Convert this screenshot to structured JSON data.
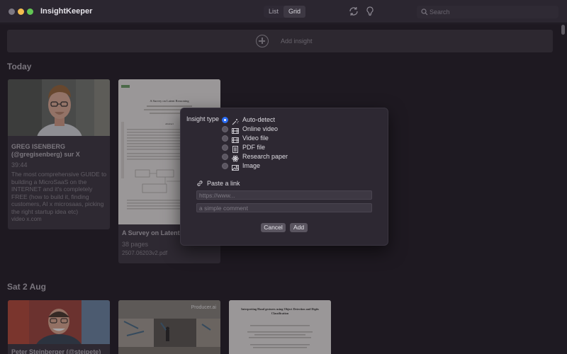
{
  "app": {
    "title": "InsightKeeper"
  },
  "toolbar": {
    "view_modes": [
      {
        "label": "List",
        "active": false
      },
      {
        "label": "Grid",
        "active": true
      }
    ],
    "refresh_icon": "refresh-icon",
    "lightbulb_icon": "lightbulb-icon",
    "search": {
      "placeholder": "Search",
      "value": ""
    }
  },
  "add_bar": {
    "label": "Add insight",
    "icon": "plus-circle-icon"
  },
  "sections": [
    {
      "title": "Today",
      "cards": [
        {
          "title_line1": "GREG ISENBERG",
          "title_line2": "(@gregisenberg) sur X",
          "meta": "39:44",
          "description_lines": [
            "The most comprehensive GUIDE to",
            "building a MicroSaaS on the",
            "INTERNET and it's completely",
            "FREE (how to build it, finding",
            "customers, AI x microsaas, picking",
            "the right startup idea etc)"
          ],
          "source": "video x.com"
        },
        {
          "title_line1": "A Survey on Latent Reasoning",
          "meta": "38 pages",
          "source": "2507.06203v2.pdf",
          "thumb_title": "A Survey on Latent Reasoning",
          "thumb_abstract": "Abstract"
        }
      ]
    },
    {
      "title": "Sat 2 Aug",
      "cards": [
        {
          "title_line1": "Peter Steinberger (@steipete)"
        },
        {
          "thumb_text": "Producer.ai"
        },
        {
          "thumb_title": "Interpreting Hand gestures using Object Detection and Digits Classification"
        }
      ]
    }
  ],
  "modal": {
    "type_label": "Insight type",
    "options": [
      {
        "label": "Auto-detect",
        "icon": "wand-icon",
        "selected": true
      },
      {
        "label": "Online video",
        "icon": "film-icon",
        "selected": false
      },
      {
        "label": "Video file",
        "icon": "film-icon",
        "selected": false
      },
      {
        "label": "PDF file",
        "icon": "document-icon",
        "selected": false
      },
      {
        "label": "Research paper",
        "icon": "atom-icon",
        "selected": false
      },
      {
        "label": "Image",
        "icon": "image-icon",
        "selected": false
      }
    ],
    "link_label": "Paste a link",
    "link_icon": "link-icon",
    "url_placeholder": "https://www...",
    "url_value": "",
    "comment_placeholder": "a simple comment",
    "comment_value": "",
    "cancel_label": "Cancel",
    "add_label": "Add"
  }
}
